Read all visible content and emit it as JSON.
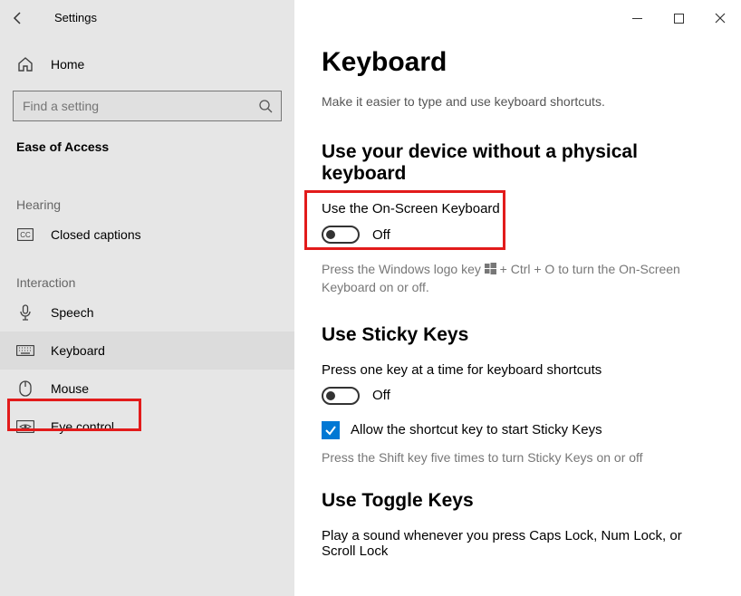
{
  "titlebar": {
    "title": "Settings"
  },
  "sidebar": {
    "home": "Home",
    "search_placeholder": "Find a setting",
    "section": "Ease of Access",
    "groups": [
      {
        "label": "Hearing",
        "items": [
          "Closed captions"
        ]
      },
      {
        "label": "Interaction",
        "items": [
          "Speech",
          "Keyboard",
          "Mouse",
          "Eye control"
        ]
      }
    ]
  },
  "main": {
    "title": "Keyboard",
    "subtitle": "Make it easier to type and use keyboard shortcuts.",
    "section_no_physical": "Use your device without a physical keyboard",
    "osc_label": "Use the On-Screen Keyboard",
    "osc_state": "Off",
    "osc_hint_pre": "Press the Windows logo key ",
    "osc_hint_post": " + Ctrl + O to turn the On-Screen Keyboard on or off.",
    "sticky_heading": "Use Sticky Keys",
    "sticky_desc": "Press one key at a time for keyboard shortcuts",
    "sticky_state": "Off",
    "sticky_checkbox_label": "Allow the shortcut key to start Sticky Keys",
    "sticky_hint": "Press the Shift key five times to turn Sticky Keys on or off",
    "toggle_heading": "Use Toggle Keys",
    "toggle_desc": "Play a sound whenever you press Caps Lock, Num Lock, or Scroll Lock"
  }
}
